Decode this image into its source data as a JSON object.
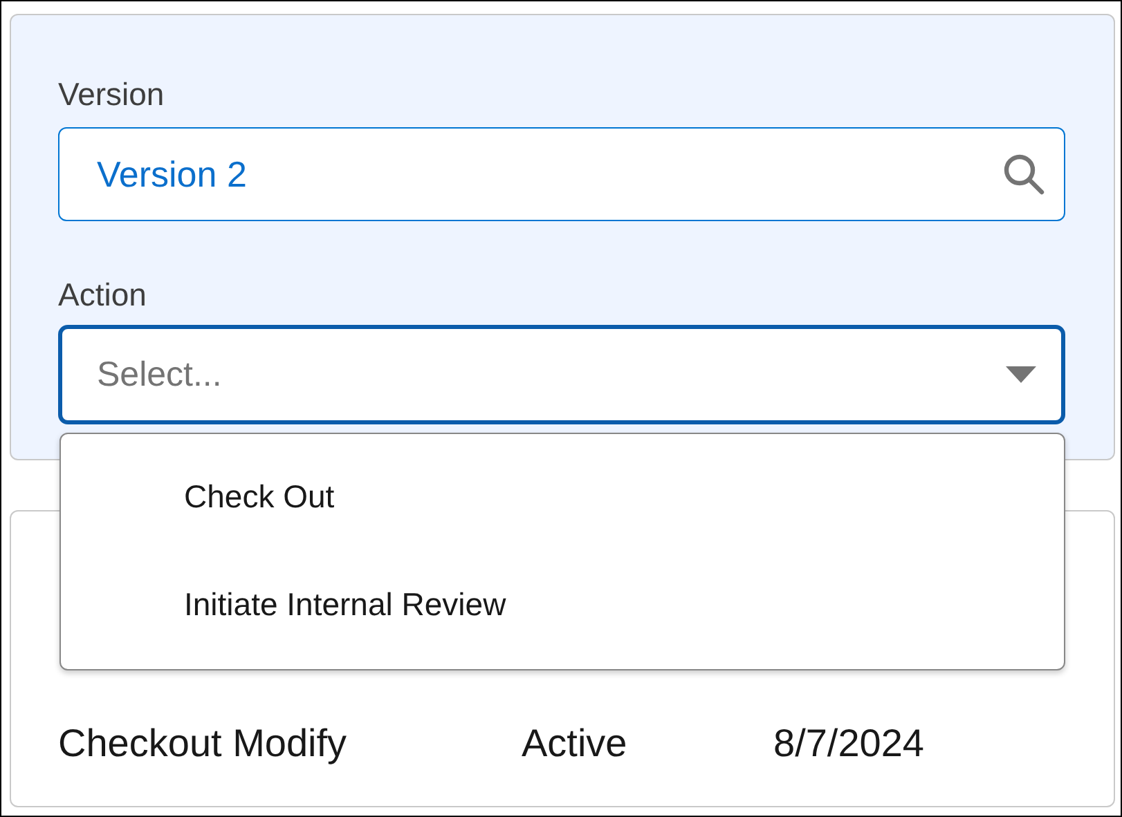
{
  "version_field": {
    "label": "Version",
    "value": "Version 2"
  },
  "action_field": {
    "label": "Action",
    "placeholder": "Select...",
    "focused": true,
    "expanded": true,
    "options": [
      {
        "label": "Check Out",
        "selected": false
      },
      {
        "label": "Initiate Internal Review",
        "selected": false
      }
    ]
  },
  "details": [
    {
      "value": "Checkout Modify"
    },
    {
      "value": "Active"
    },
    {
      "value": "8/7/2024"
    }
  ]
}
